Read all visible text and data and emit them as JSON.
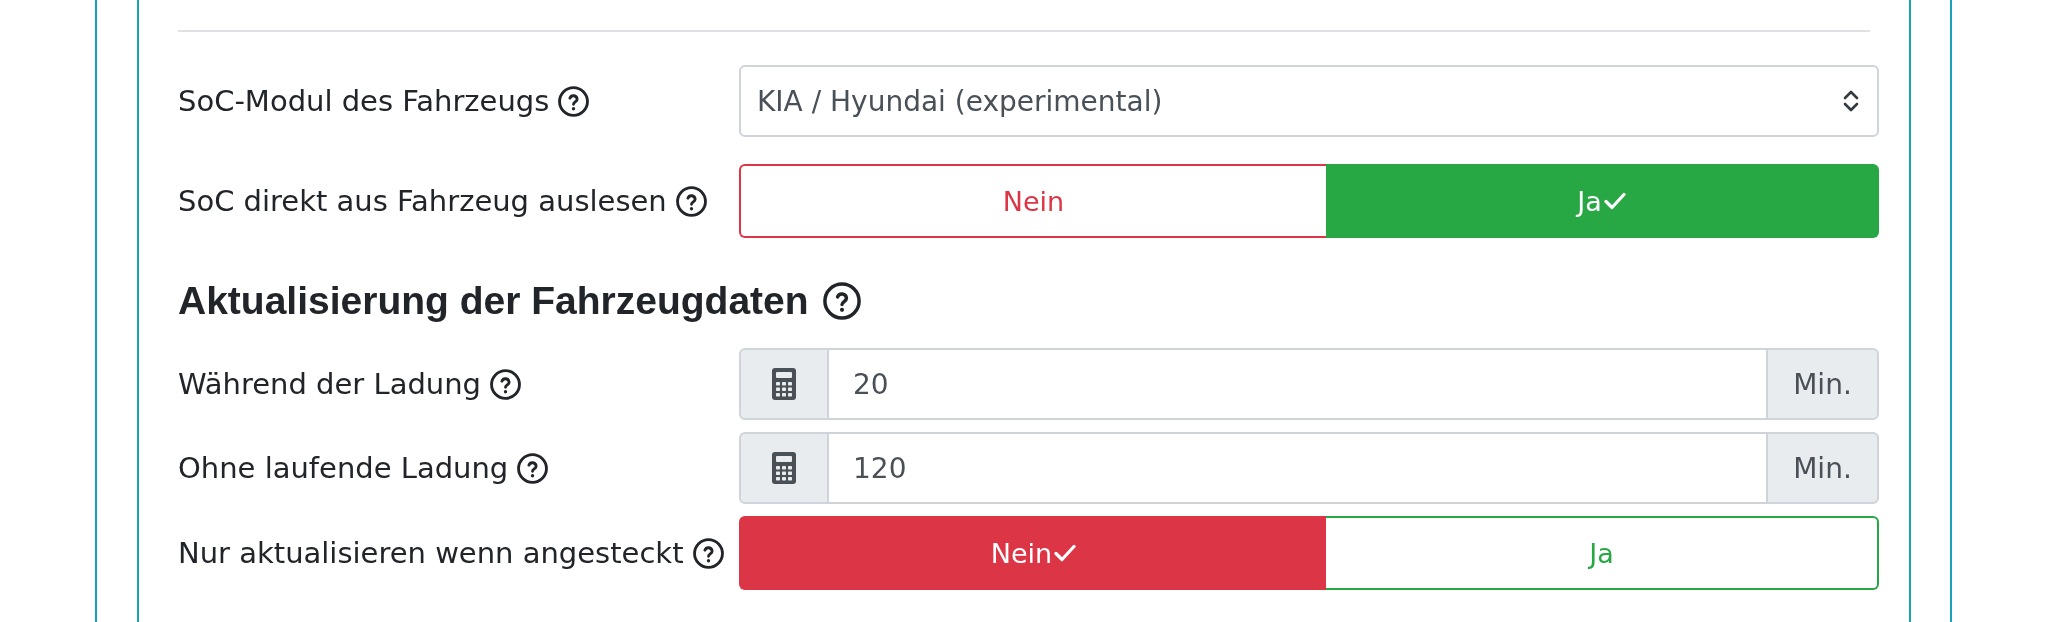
{
  "fields": [
    {
      "kind": "select",
      "label": "SoC-Modul des Fahrzeugs",
      "value": "KIA / Hyundai (experimental)"
    },
    {
      "kind": "toggle",
      "label": "SoC direkt aus Fahrzeug auslesen",
      "options": [
        {
          "label": "Nein",
          "color": "#dc3545",
          "selected": false
        },
        {
          "label": "Ja",
          "color": "#28a745",
          "selected": true
        }
      ]
    }
  ],
  "section": {
    "title": "Aktualisierung der Fahrzeugdaten",
    "fields": [
      {
        "kind": "number",
        "label": "Während der Ladung",
        "value": "20",
        "unit": "Min."
      },
      {
        "kind": "number",
        "label": "Ohne laufende Ladung",
        "value": "120",
        "unit": "Min."
      },
      {
        "kind": "toggle",
        "label": "Nur aktualisieren wenn angesteckt",
        "options": [
          {
            "label": "Nein",
            "color": "#dc3545",
            "selected": true
          },
          {
            "label": "Ja",
            "color": "#28a745",
            "selected": false
          }
        ]
      }
    ]
  }
}
